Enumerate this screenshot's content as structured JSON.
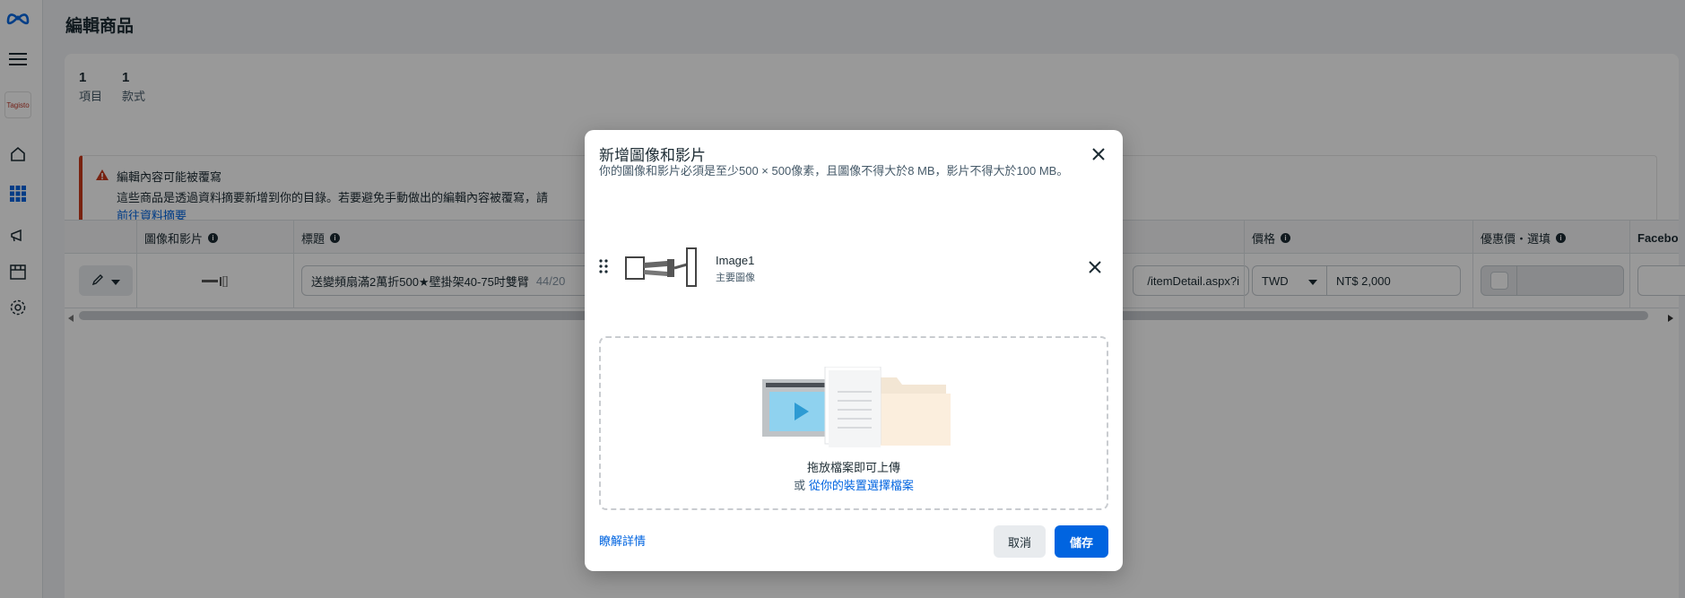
{
  "page": {
    "title": "編輯商品"
  },
  "rail": {
    "brand_text": "Tagisto"
  },
  "summary": [
    {
      "num": "1",
      "label": "項目"
    },
    {
      "num": "1",
      "label": "款式"
    }
  ],
  "warning": {
    "title": "編輯內容可能被覆寫",
    "body": "這些商品是透過資料摘要新增到你的目錄。若要避免手動做出的編輯內容被覆寫，請",
    "link": "前往資料摘要"
  },
  "table": {
    "headers": {
      "media": "圖像和影片",
      "title": "標題",
      "price": "價格",
      "sale_price": "優惠價・選填",
      "facebook": "Facebo"
    },
    "row": {
      "title_value": "送變頻扇滿2萬折500★壁掛架40-75吋雙臂",
      "title_count": "44/20",
      "link_value": "/itemDetail.aspx?i",
      "currency": "TWD",
      "price_value": "NT$ 2,000"
    }
  },
  "modal": {
    "title": "新增圖像和影片",
    "subtitle": "你的圖像和影片必須是至少500 × 500像素，且圖像不得大於8 MB，影片不得大於100 MB。",
    "item": {
      "name": "Image1",
      "role": "主要圖像"
    },
    "dropzone": {
      "primary": "拖放檔案即可上傳",
      "or": "或",
      "link": "從你的裝置選擇檔案"
    },
    "learn_more": "瞭解詳情",
    "cancel": "取消",
    "save": "儲存"
  },
  "colors": {
    "accent": "#0064e0",
    "warning": "#c8391b"
  }
}
